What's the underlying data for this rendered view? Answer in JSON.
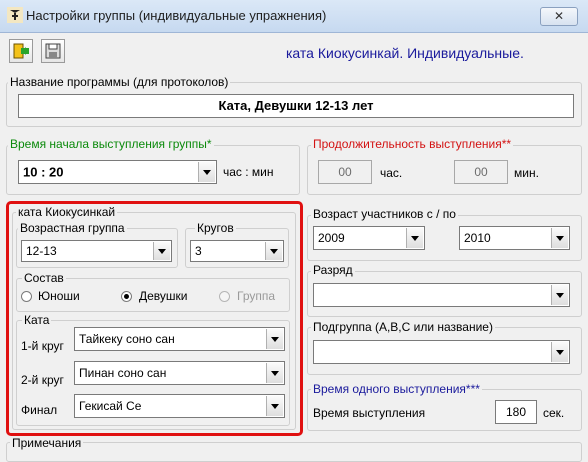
{
  "window": {
    "title": "Настройки группы (индивидуальные упражнения)",
    "close_glyph": "✕"
  },
  "toolbar": {
    "caption": "ката Киокусинкай. Индивидуальные."
  },
  "program": {
    "legend": "Название программы (для протоколов)",
    "value": "Ката, Девушки 12-13 лет"
  },
  "start_time": {
    "legend": "Время начала выступления группы*",
    "value": "10 : 20",
    "unit": "час : мин"
  },
  "duration": {
    "legend": "Продолжительность выступления**",
    "hours_value": "00",
    "hours_unit": "час.",
    "minutes_value": "00",
    "minutes_unit": "мин."
  },
  "kata_group": {
    "legend": "ката Киокусинкай",
    "age_group": {
      "legend": "Возрастная группа",
      "value": "12-13"
    },
    "rounds": {
      "legend": "Кругов",
      "value": "3"
    },
    "composition": {
      "legend": "Состав",
      "options": [
        "Юноши",
        "Девушки",
        "Группа"
      ],
      "selected": "Девушки"
    },
    "kata": {
      "legend": "Ката",
      "rows": [
        {
          "label": "1-й круг",
          "value": "Тайкеку соно сан"
        },
        {
          "label": "2-й круг",
          "value": "Пинан соно сан"
        },
        {
          "label": "Финал",
          "value": "Гекисай Се"
        }
      ]
    }
  },
  "participants_age": {
    "legend": "Возраст участников с / по",
    "from": "2009",
    "to": "2010"
  },
  "rank": {
    "legend": "Разряд",
    "value": ""
  },
  "subgroup": {
    "legend": "Подгруппа (А,В,С или название)",
    "value": ""
  },
  "performance_time": {
    "legend": "Время одного выступления***",
    "label": "Время выступления",
    "value": "180",
    "unit": "сек."
  },
  "notes": {
    "legend": "Примечания"
  },
  "colors": {
    "accent_blue": "#1a1a9c",
    "green": "#0b8a0b",
    "red": "#d31212",
    "highlight": "#e01010"
  },
  "icons": [
    "app-icon",
    "exit-icon",
    "save-icon",
    "close-icon",
    "chevron-down-icon"
  ]
}
